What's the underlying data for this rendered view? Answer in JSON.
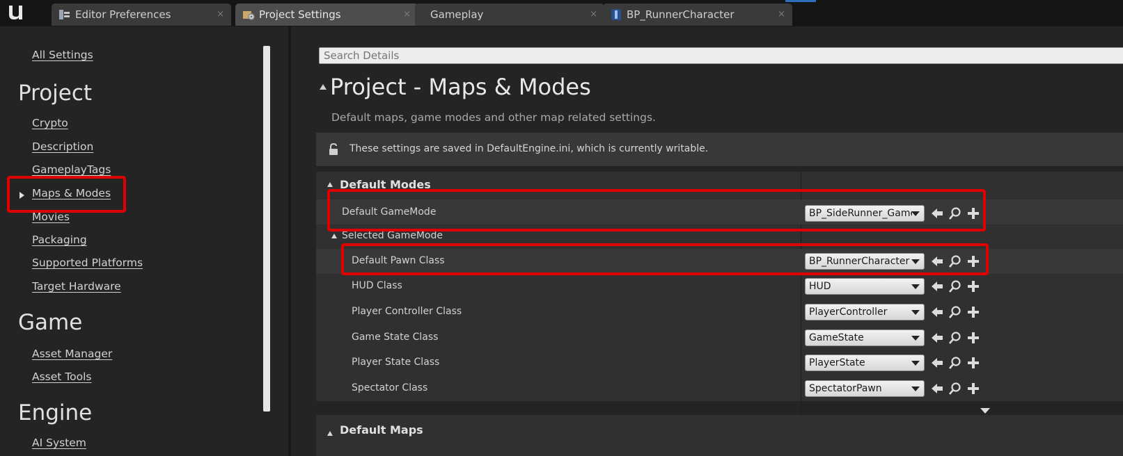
{
  "tabs": [
    {
      "label": "Editor Preferences",
      "icon": "preferences-icon",
      "close": "×"
    },
    {
      "label": "Project Settings",
      "icon": "project-settings-icon",
      "close": "×"
    },
    {
      "label": "Gameplay",
      "icon": "",
      "close": "×"
    },
    {
      "label": "BP_RunnerCharacter",
      "icon": "blueprint-icon",
      "close": "×"
    }
  ],
  "sidebar": {
    "all_settings": "All Settings",
    "sections": [
      {
        "heading": "Project",
        "items": [
          "Crypto",
          "Description",
          "GameplayTags",
          "Maps & Modes",
          "Movies",
          "Packaging",
          "Supported Platforms",
          "Target Hardware"
        ]
      },
      {
        "heading": "Game",
        "items": [
          "Asset Manager",
          "Asset Tools"
        ]
      },
      {
        "heading": "Engine",
        "items": [
          "AI System"
        ]
      }
    ],
    "selected_item": "Maps & Modes"
  },
  "main": {
    "search_placeholder": "Search Details",
    "title": "Project - Maps & Modes",
    "subtitle": "Default maps, game modes and other map related settings.",
    "notice": "These settings are saved in DefaultEngine.ini, which is currently writable.",
    "default_modes": {
      "header": "Default Modes",
      "default_gamemode": {
        "label": "Default GameMode",
        "value": "BP_SideRunner_GameMode"
      },
      "selected_gamemode": {
        "header": "Selected GameMode",
        "properties": [
          {
            "label": "Default Pawn Class",
            "value": "BP_RunnerCharacter"
          },
          {
            "label": "HUD Class",
            "value": "HUD"
          },
          {
            "label": "Player Controller Class",
            "value": "PlayerController"
          },
          {
            "label": "Game State Class",
            "value": "GameState"
          },
          {
            "label": "Player State Class",
            "value": "PlayerState"
          },
          {
            "label": "Spectator Class",
            "value": "SpectatorPawn"
          }
        ]
      }
    },
    "default_maps": {
      "header": "Default Maps"
    }
  },
  "colors": {
    "highlight": "#e00000",
    "background": "#242424",
    "panel": "#303030",
    "tab_accent": "#2b6fb8"
  }
}
